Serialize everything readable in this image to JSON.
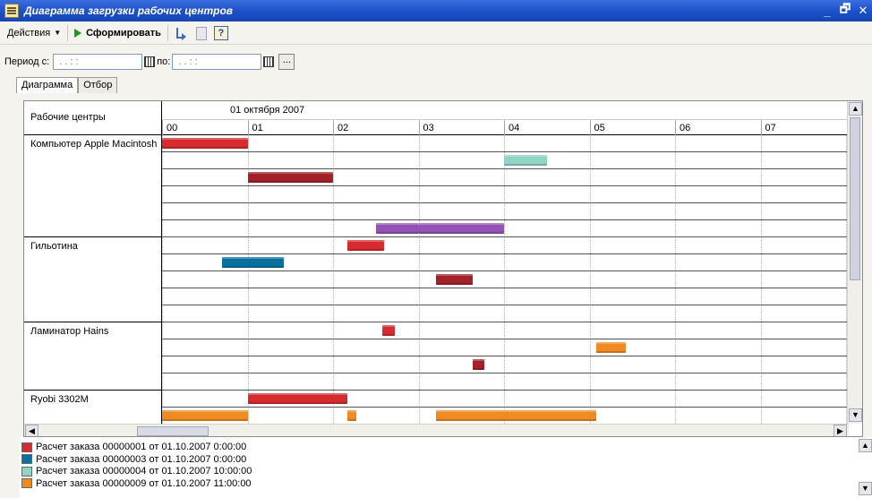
{
  "window": {
    "title": "Диаграмма загрузки рабочих центров"
  },
  "toolbar": {
    "actions_label": "Действия",
    "generate_label": "Сформировать",
    "help_label": "?"
  },
  "period": {
    "from_label": "Период с:",
    "from_value": " .  .     :  :",
    "to_label": "по:",
    "to_value": " .  .     :  :",
    "dots_label": "..."
  },
  "tabs": [
    {
      "label": "Диаграмма"
    },
    {
      "label": "Отбор"
    }
  ],
  "chart": {
    "header_label": "Рабочие центры",
    "date_label": "01 октября 2007",
    "hours": [
      "00",
      "01",
      "02",
      "03",
      "04",
      "05",
      "06",
      "07"
    ],
    "groups": [
      {
        "name": "Компьютер Apple Macintosh",
        "rows": 6
      },
      {
        "name": "Гильотина",
        "rows": 5
      },
      {
        "name": "Ламинатор Hains",
        "rows": 4
      },
      {
        "name": "Ryobi 3302M",
        "rows": 2
      }
    ],
    "bars": [
      {
        "row": 0,
        "start": 0.0,
        "end": 1.0,
        "color": "#d62b2f"
      },
      {
        "row": 1,
        "start": 4.0,
        "end": 4.5,
        "color": "#8fd4c4"
      },
      {
        "row": 2,
        "start": 1.0,
        "end": 2.0,
        "color": "#a3222a"
      },
      {
        "row": 5,
        "start": 2.5,
        "end": 3.0,
        "color": "#9254b4"
      },
      {
        "row": 5,
        "start": 3.0,
        "end": 4.0,
        "color": "#9254b4"
      },
      {
        "row": 6,
        "start": 2.17,
        "end": 2.6,
        "color": "#d62b2f"
      },
      {
        "row": 7,
        "start": 0.7,
        "end": 1.42,
        "color": "#0b6fa0"
      },
      {
        "row": 8,
        "start": 3.2,
        "end": 3.63,
        "color": "#a3222a"
      },
      {
        "row": 11,
        "start": 2.58,
        "end": 2.72,
        "color": "#d62b2f"
      },
      {
        "row": 12,
        "start": 5.08,
        "end": 5.42,
        "color": "#f08a22"
      },
      {
        "row": 13,
        "start": 3.63,
        "end": 3.77,
        "color": "#a3222a"
      },
      {
        "row": 15,
        "start": 1.0,
        "end": 2.17,
        "color": "#d62b2f"
      },
      {
        "row": 16,
        "start": 0.0,
        "end": 1.0,
        "color": "#f08a22"
      },
      {
        "row": 16,
        "start": 2.17,
        "end": 2.27,
        "color": "#f08a22"
      },
      {
        "row": 16,
        "start": 3.2,
        "end": 5.08,
        "color": "#f08a22"
      }
    ]
  },
  "legend": [
    {
      "label": "Расчет заказа 00000001 от 01.10.2007 0:00:00",
      "color": "#d62b2f"
    },
    {
      "label": "Расчет заказа 00000003 от 01.10.2007 0:00:00",
      "color": "#0b6fa0"
    },
    {
      "label": "Расчет заказа 00000004 от 01.10.2007 10:00:00",
      "color": "#8fd4c4"
    },
    {
      "label": "Расчет заказа 00000009 от 01.10.2007 11:00:00",
      "color": "#f08a22"
    }
  ]
}
